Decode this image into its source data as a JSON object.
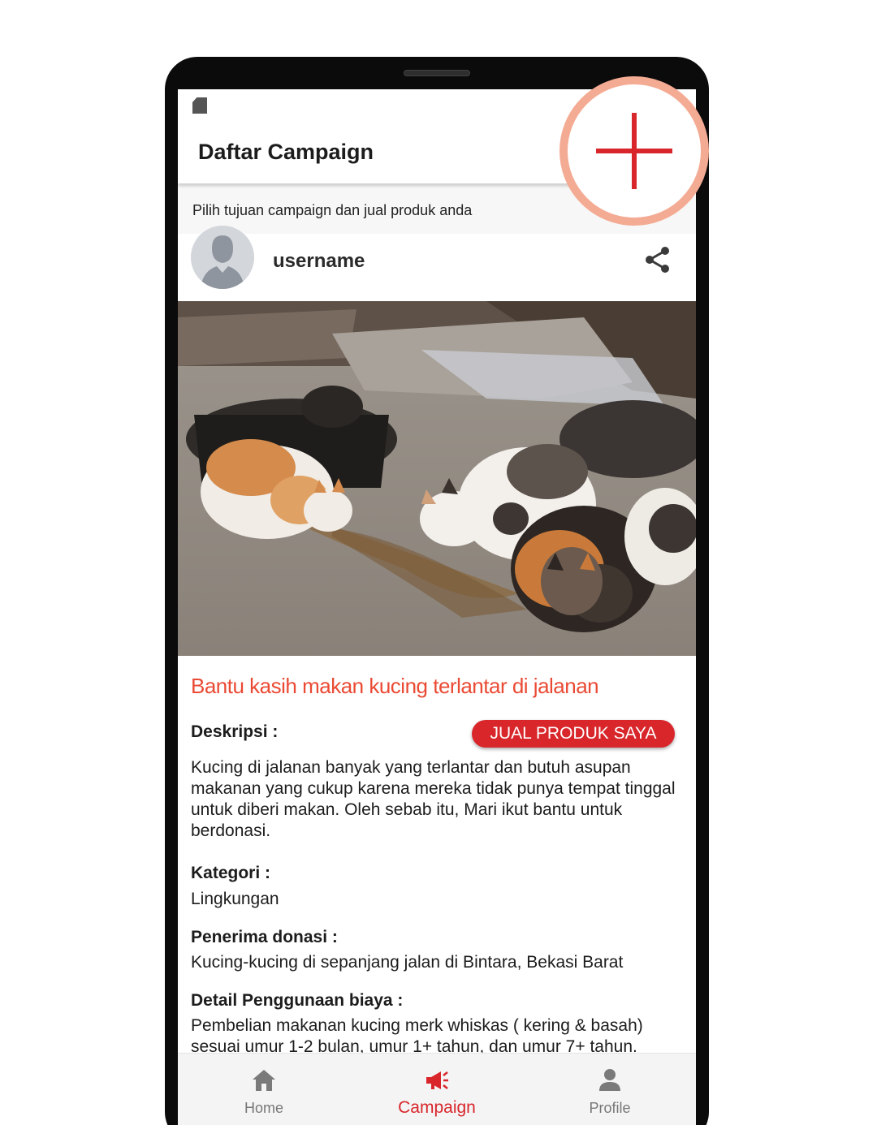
{
  "appbar": {
    "title": "Daftar Campaign"
  },
  "subtitle": "Pilih tujuan campaign dan jual produk anda",
  "post": {
    "username": "username",
    "title": "Bantu kasih makan kucing terlantar di jalanan",
    "sell_button": "JUAL PRODUK SAYA",
    "description_label": "Deskripsi :",
    "description": "Kucing di jalanan banyak yang terlantar dan butuh asupan makanan yang cukup karena mereka tidak punya tempat tinggal untuk diberi makan. Oleh sebab itu, Mari ikut bantu untuk berdonasi.",
    "category_label": "Kategori :",
    "category": "Lingkungan",
    "recipient_label": "Penerima donasi :",
    "recipient": "Kucing-kucing di sepanjang jalan di Bintara, Bekasi Barat",
    "cost_label": "Detail Penggunaan biaya :",
    "cost_detail": "Pembelian makanan kucing merk whiskas ( kering & basah) sesuai umur 1-2 bulan, umur 1+ tahun, dan umur 7+ tahun."
  },
  "nav": {
    "items": [
      {
        "label": "Home",
        "icon": "home-icon",
        "active": false
      },
      {
        "label": "Campaign",
        "icon": "megaphone-icon",
        "active": true
      },
      {
        "label": "Profile",
        "icon": "person-icon",
        "active": false
      }
    ]
  },
  "colors": {
    "accent": "#d8262b",
    "title_orange": "#ea4a34",
    "fab_ring": "#f4ab94",
    "inactive_nav": "#777777"
  },
  "icons": {
    "status": "sd-card-icon",
    "share": "share-icon",
    "fab": "plus-icon",
    "avatar": "avatar-placeholder-icon"
  }
}
